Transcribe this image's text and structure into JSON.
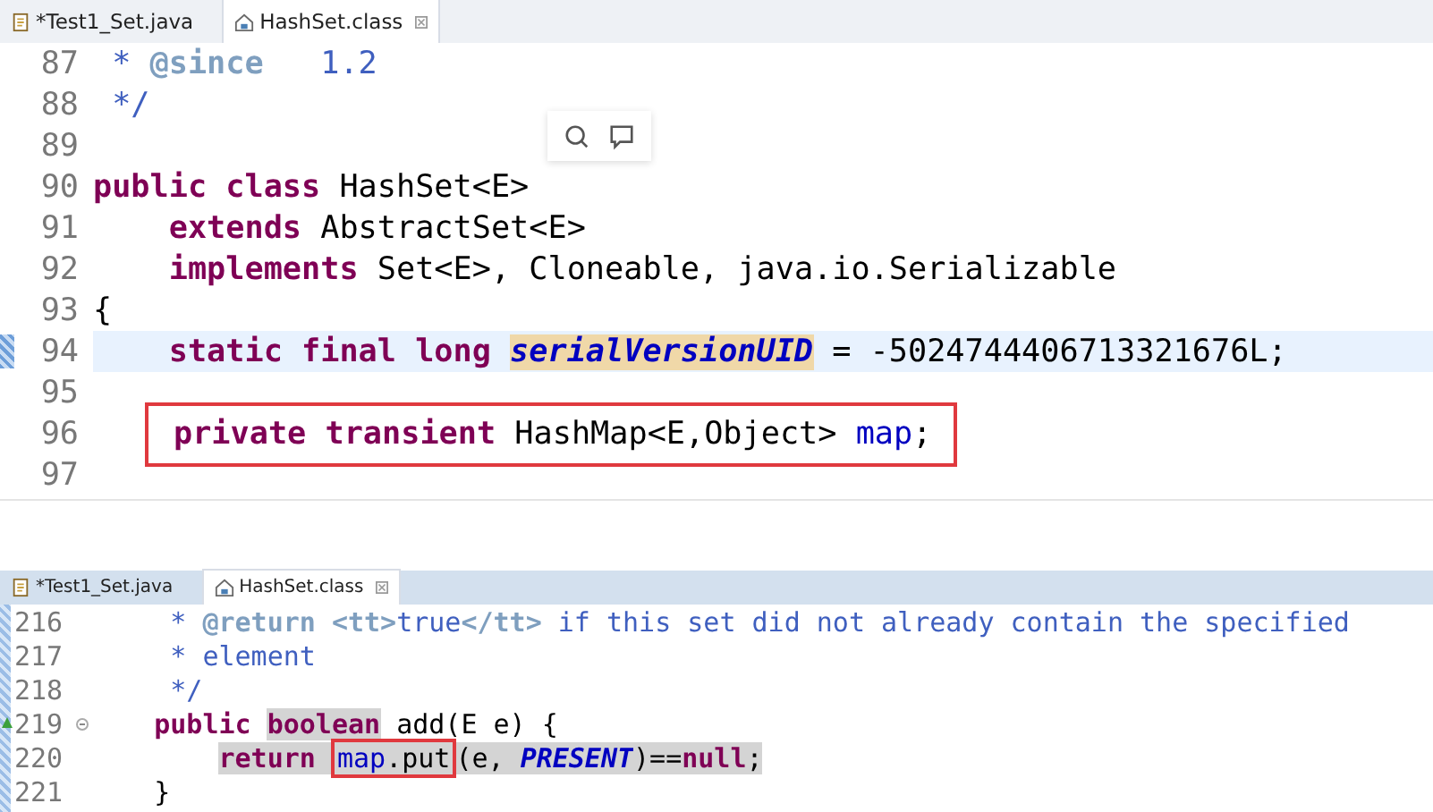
{
  "panels": [
    {
      "tabs": [
        {
          "label": "*Test1_Set.java",
          "kind": "java",
          "selected": false
        },
        {
          "label": "HashSet.class",
          "kind": "class",
          "selected": true
        }
      ],
      "lines": [
        {
          "number": "87",
          "tokens": [
            {
              "text": " * ",
              "kind": "comment"
            },
            {
              "text": "@since",
              "kind": "doc-tag"
            },
            {
              "text": "   1.2",
              "kind": "comment"
            }
          ]
        },
        {
          "number": "88",
          "tokens": [
            {
              "text": " */",
              "kind": "comment"
            }
          ]
        },
        {
          "number": "89"
        },
        {
          "number": "90",
          "tokens": [
            {
              "text": "public class",
              "kind": "keyword"
            },
            {
              "text": " HashSet<E>",
              "kind": "text"
            }
          ]
        },
        {
          "number": "91",
          "tokens": [
            {
              "text": "    extends",
              "kind": "keyword"
            },
            {
              "text": " AbstractSet<E>",
              "kind": "text"
            }
          ]
        },
        {
          "number": "92",
          "tokens": [
            {
              "text": "    implements",
              "kind": "keyword"
            },
            {
              "text": " Set<E>, Cloneable, java.io.Serializable",
              "kind": "text"
            }
          ]
        },
        {
          "number": "93",
          "tokens": [
            {
              "text": "{",
              "kind": "text"
            }
          ]
        },
        {
          "number": "94",
          "current": true,
          "tokens": [
            {
              "text": "    static final long ",
              "kind": "keyword"
            },
            {
              "text": "serialVersionUID",
              "kind": "constant",
              "occurrence": true
            },
            {
              "text": " = -5024744406713321676L;",
              "kind": "text"
            }
          ]
        },
        {
          "number": "95"
        },
        {
          "number": "96",
          "tokens": [
            {
              "kind": "box",
              "tokens": [
                {
                  "text": "private transient",
                  "kind": "keyword"
                },
                {
                  "text": " HashMap<E,Object> ",
                  "kind": "text"
                },
                {
                  "text": "map",
                  "kind": "field"
                },
                {
                  "text": ";",
                  "kind": "text"
                }
              ]
            }
          ]
        },
        {
          "number": "97"
        }
      ]
    },
    {
      "tabs": [
        {
          "label": "*Test1_Set.java",
          "kind": "java",
          "selected": false
        },
        {
          "label": "HashSet.class",
          "kind": "class",
          "selected": true
        }
      ],
      "lines": [
        {
          "number": "216",
          "tokens": [
            {
              "text": "     * ",
              "kind": "comment"
            },
            {
              "text": "@return",
              "kind": "doc-tag"
            },
            {
              "text": " <tt>",
              "kind": "doc-tag"
            },
            {
              "text": "true",
              "kind": "comment"
            },
            {
              "text": "</tt>",
              "kind": "doc-tag"
            },
            {
              "text": " if this set did not already contain the specified",
              "kind": "comment"
            }
          ]
        },
        {
          "number": "217",
          "tokens": [
            {
              "text": "     * element",
              "kind": "comment"
            }
          ]
        },
        {
          "number": "218",
          "tokens": [
            {
              "text": "     */",
              "kind": "comment"
            }
          ]
        },
        {
          "number": "219",
          "override": true,
          "tokens": [
            {
              "text": "    public ",
              "kind": "keyword"
            },
            {
              "text": "boolean",
              "kind": "keyword",
              "exit_point": true
            },
            {
              "text": " add(E e) {",
              "kind": "text"
            }
          ]
        },
        {
          "number": "220",
          "tokens": [
            {
              "text": "        return ",
              "kind": "keyword",
              "exit_point": true
            },
            {
              "kind": "box",
              "exit_point": true,
              "tokens": [
                {
                  "text": "map",
                  "kind": "field"
                },
                {
                  "text": ".put",
                  "kind": "text"
                }
              ]
            },
            {
              "text": "(e, ",
              "kind": "text",
              "exit_point": true
            },
            {
              "text": "PRESENT",
              "kind": "constant",
              "exit_point": true
            },
            {
              "text": ")==",
              "kind": "text",
              "exit_point": true
            },
            {
              "text": "null",
              "kind": "keyword",
              "exit_point": true
            },
            {
              "text": ";",
              "kind": "text",
              "exit_point": true
            }
          ]
        },
        {
          "number": "221",
          "tokens": [
            {
              "text": "    }",
              "kind": "text"
            }
          ]
        }
      ]
    }
  ]
}
